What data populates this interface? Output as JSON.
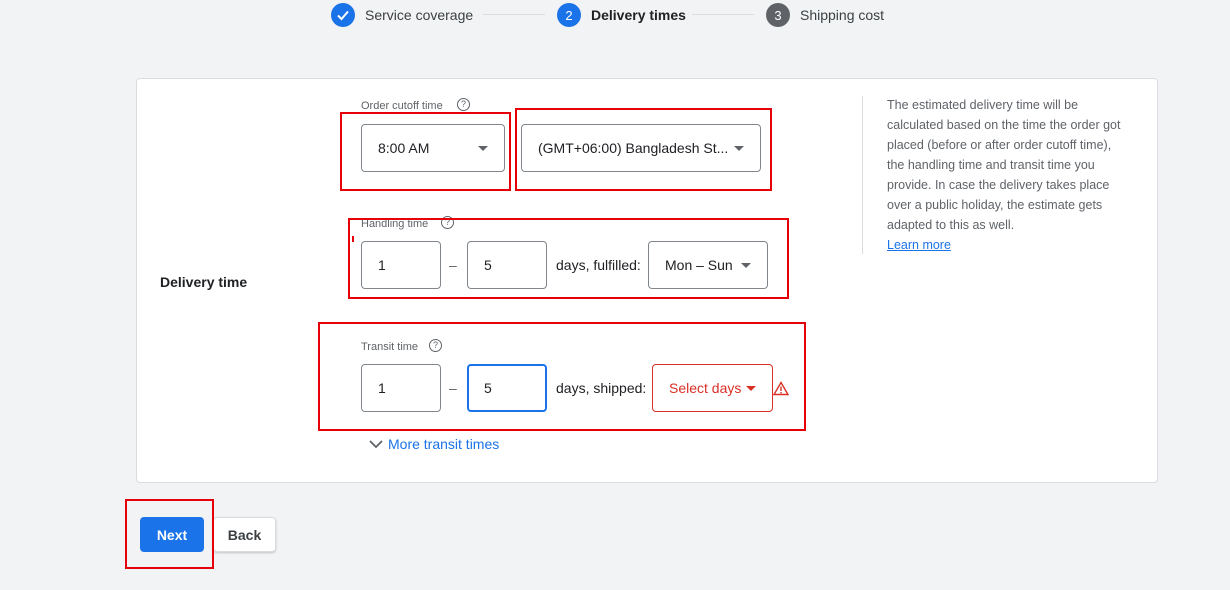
{
  "stepper": {
    "steps": [
      {
        "number": "✓",
        "label": "Service coverage",
        "state": "done"
      },
      {
        "number": "2",
        "label": "Delivery times",
        "state": "active"
      },
      {
        "number": "3",
        "label": "Shipping cost",
        "state": "pending"
      }
    ]
  },
  "delivery": {
    "section_label": "Delivery time",
    "cutoff_label": "Order cutoff time",
    "cutoff_value": "8:00 AM",
    "timezone_value": "(GMT+06:00) Bangladesh St...",
    "handling_label": "Handling time",
    "handling_min": "1",
    "handling_max": "5",
    "handling_suffix": "days, fulfilled:",
    "handling_days": "Mon – Sun",
    "transit_label": "Transit time",
    "transit_min": "1",
    "transit_max": "5",
    "transit_suffix": "days, shipped:",
    "transit_days": "Select days",
    "more_transit": "More transit times",
    "dash": "–"
  },
  "info": {
    "text": "The estimated delivery time will be calculated based on the time the order got placed (before or after order cutoff time), the handling time and transit time you provide. In case the delivery takes place over a public holiday, the estimate gets adapted to this as well.",
    "learn_more": "Learn more"
  },
  "actions": {
    "next": "Next",
    "back": "Back"
  },
  "colors": {
    "accent": "#1a73e8",
    "error": "#d93025",
    "annotation": "#e5000a"
  }
}
